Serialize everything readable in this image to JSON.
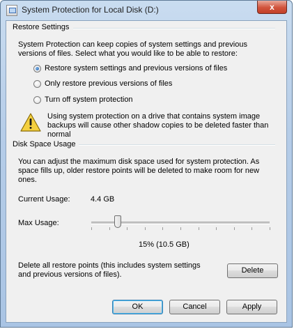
{
  "window": {
    "title": "System Protection for Local Disk (D:)",
    "close_glyph": "x"
  },
  "restore_settings": {
    "group_label": "Restore Settings",
    "description": "System Protection can keep copies of system settings and previous versions of files. Select what you would like to be able to restore:",
    "options": [
      {
        "label": "Restore system settings and previous versions of files",
        "selected": true
      },
      {
        "label": "Only restore previous versions of files",
        "selected": false
      },
      {
        "label": "Turn off system protection",
        "selected": false
      }
    ],
    "warning_icon": "warning-triangle-icon",
    "warning_text": "Using system protection on a drive that contains system image backups will cause other shadow copies to be deleted faster than normal"
  },
  "disk_space": {
    "group_label": "Disk Space Usage",
    "description": "You can adjust the maximum disk space used for system protection. As space fills up, older restore points will be deleted to make room for new ones.",
    "current_usage_label": "Current Usage:",
    "current_usage_value": "4.4 GB",
    "max_usage_label": "Max Usage:",
    "max_usage_fraction": 0.15,
    "max_usage_text": "15% (10.5 GB)",
    "delete_text": "Delete all restore points (this includes system settings and previous versions of files).",
    "delete_button": "Delete"
  },
  "buttons": {
    "ok": "OK",
    "cancel": "Cancel",
    "apply": "Apply"
  },
  "colors": {
    "title_bar": "#b6cde8",
    "dialog_bg": "#f0f0f0",
    "close_button": "#d1533c",
    "default_button_focus": "#48b8ee"
  }
}
